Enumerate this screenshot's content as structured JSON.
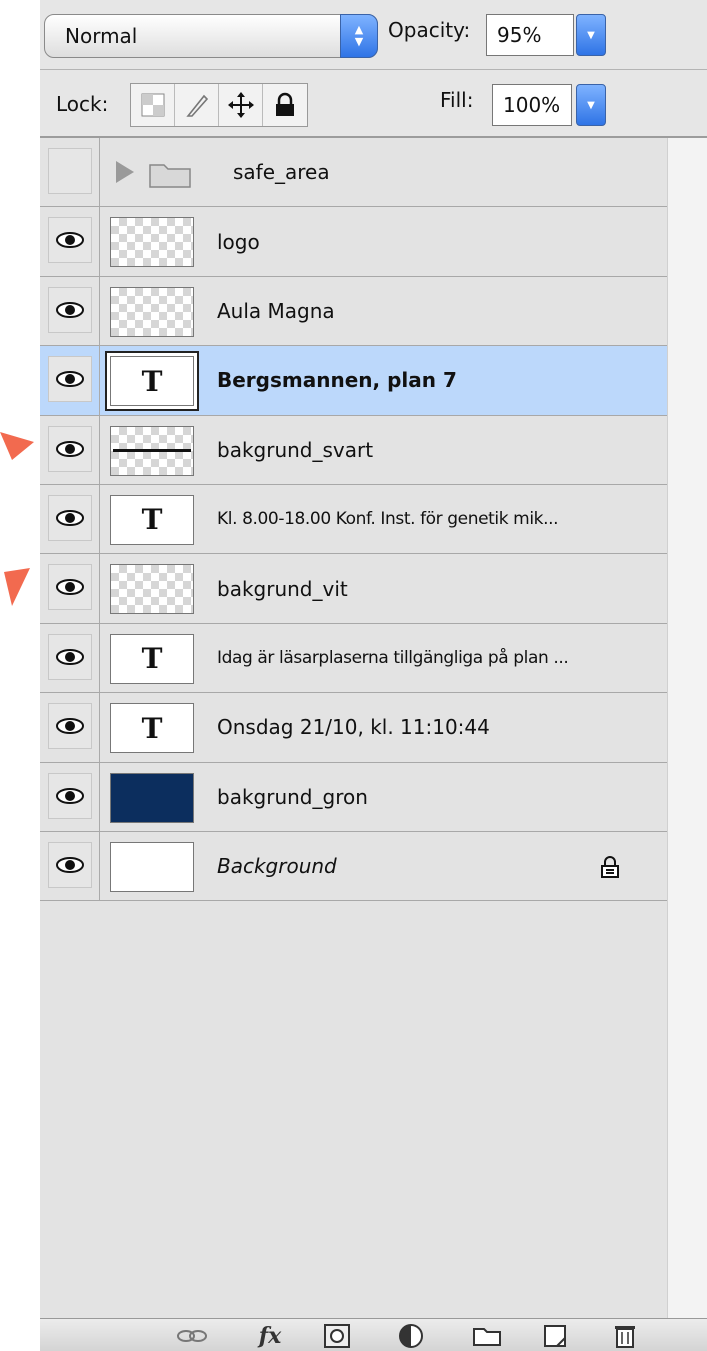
{
  "toolbar": {
    "blend_mode": "Normal",
    "opacity_label": "Opacity:",
    "opacity_value": "95%",
    "lock_label": "Lock:",
    "fill_label": "Fill:",
    "fill_value": "100%"
  },
  "layers": [
    {
      "name": "safe_area",
      "kind": "group",
      "visible": false
    },
    {
      "name": "logo",
      "kind": "raster",
      "visible": true
    },
    {
      "name": "Aula Magna",
      "kind": "raster",
      "visible": true
    },
    {
      "name": "Bergsmannen, plan 7",
      "kind": "text",
      "visible": true,
      "selected": true
    },
    {
      "name": "bakgrund_svart",
      "kind": "raster",
      "visible": true
    },
    {
      "name": "Kl. 8.00-18.00 Konf. Inst. för genetik mik...",
      "kind": "text",
      "visible": true
    },
    {
      "name": "bakgrund_vit",
      "kind": "raster",
      "visible": true
    },
    {
      "name": "Idag är läsarplaserna tillgängliga på plan ...",
      "kind": "text",
      "visible": true
    },
    {
      "name": "Onsdag 21/10, kl. 11:10:44",
      "kind": "text",
      "visible": true
    },
    {
      "name": "bakgrund_gron",
      "kind": "fill",
      "visible": true,
      "color": "#0c2e5e"
    },
    {
      "name": "Background",
      "kind": "background",
      "visible": true,
      "locked": true
    }
  ],
  "colors": {
    "selection": "#bcd8fb",
    "accent": "#2f74e6",
    "arrow": "#f26a4f"
  },
  "bottom_icons": [
    "link-icon",
    "fx-icon",
    "mask-icon",
    "adjustment-icon",
    "folder-icon",
    "new-layer-icon",
    "trash-icon"
  ]
}
